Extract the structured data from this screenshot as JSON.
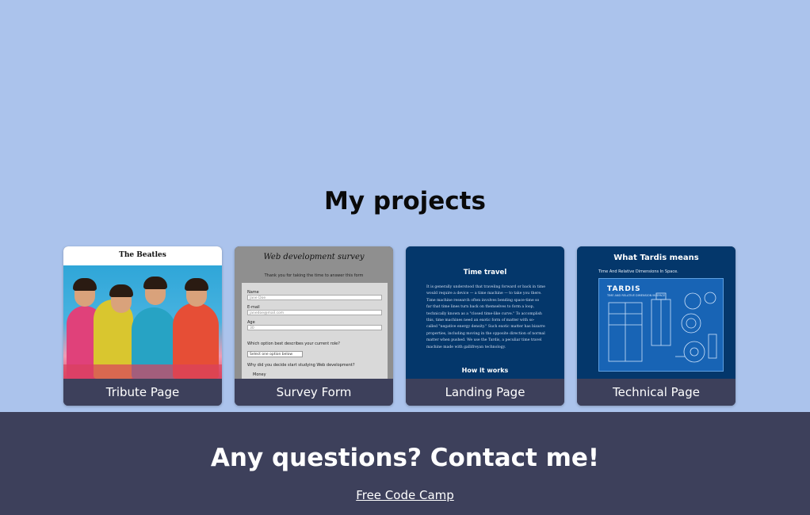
{
  "projects": {
    "heading": "My projects",
    "cards": [
      {
        "caption": "Tribute Page",
        "thumb_title": "The Beatles"
      },
      {
        "caption": "Survey Form",
        "thumb_title": "Web development survey",
        "thumb_subtitle": "Thank you for taking the time to answer this form",
        "fields": {
          "name_label": "Name",
          "name_placeholder": "Jane Doe",
          "email_label": "E-mail",
          "email_placeholder": "janedoe@mail.com",
          "age_label": "Age",
          "age_placeholder": "30",
          "role_question": "Which option best describes your current role?",
          "role_select": "Select one option below",
          "why_question": "Why did you decide start studying Web development?",
          "why_option": "Money"
        }
      },
      {
        "caption": "Landing Page",
        "thumb_title": "Time travel",
        "thumb_paragraph": "It is generally understood that traveling forward or back in time would require a device — a time machine — to take you there. Time machine research often involves bending space-time so far that time lines turn back on themselves to form a loop, technically known as a \"closed time-like curve.\" To accomplish this, time machines need an exotic form of matter with so-called \"negative energy density.\" Such exotic matter has bizarre properties, including moving in the opposite direction of normal matter when pushed. We use the Tardis, a peculiar time travel machine made with gallifreyan technology.",
        "thumb_title2": "How it works"
      },
      {
        "caption": "Technical Page",
        "thumb_title": "What Tardis means",
        "thumb_subtitle": "Time And Relative Dimensions In Space.",
        "blueprint_title": "TARDIS",
        "blueprint_subtitle": "TIME AND RELATIVE DIMENSION IN SPACE"
      }
    ]
  },
  "footer": {
    "heading": "Any questions? Contact me!",
    "link": "Free Code Camp"
  },
  "colors": {
    "background": "#abc3ec",
    "footer": "#3d405b",
    "caption": "#3d405b",
    "navy_thumb": "#04376b"
  }
}
